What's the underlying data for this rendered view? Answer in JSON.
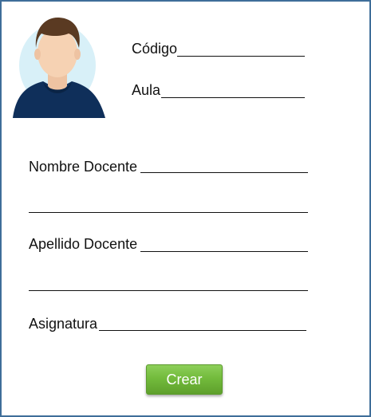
{
  "form": {
    "codigo_label": "Código",
    "aula_label": "Aula",
    "nombre_docente_label": "Nombre Docente",
    "apellido_docente_label": "Apellido Docente",
    "asignatura_label": "Asignatura",
    "crear_button_label": "Crear"
  },
  "avatar": {
    "icon": "person-avatar-icon"
  },
  "colors": {
    "border": "#3f6e99",
    "button_green": "#6fb83a",
    "avatar_bg": "#d8f0f8",
    "avatar_shirt": "#0f2f5a",
    "avatar_hair": "#5a3a22",
    "avatar_skin": "#f6d2b3"
  }
}
